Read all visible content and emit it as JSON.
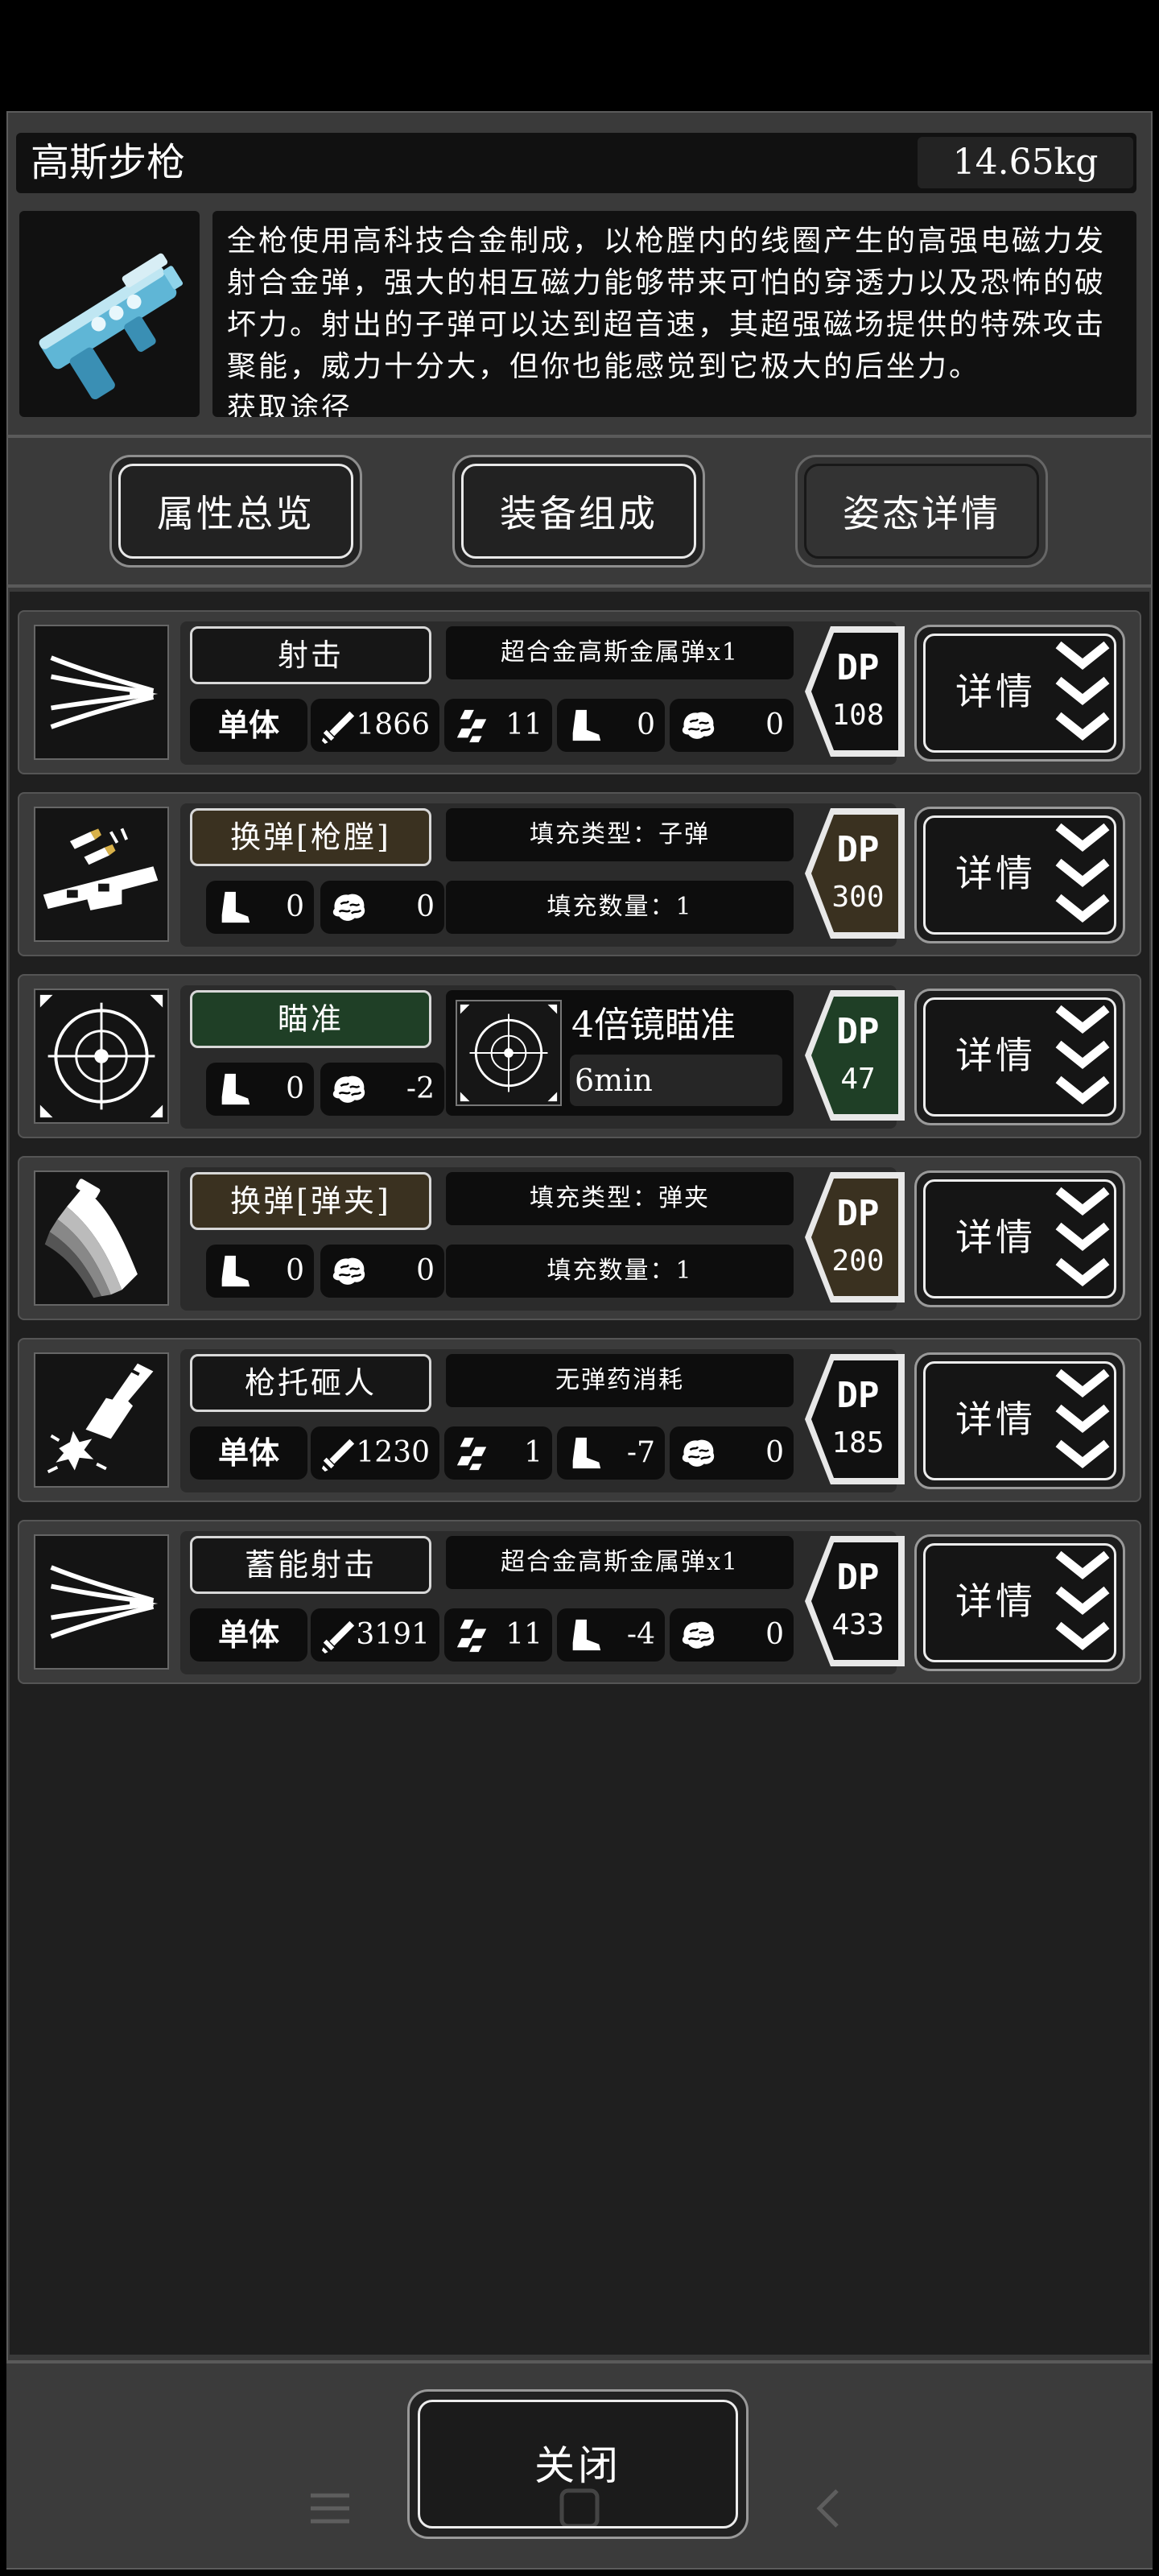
{
  "item": {
    "name": "高斯步枪",
    "weight": "14.65kg",
    "description": "全枪使用高科技合金制成，以枪膛内的线圈产生的高强电磁力发射合金弹，强大的相互磁力能够带来可怕的穿透力以及恐怖的破坏力。射出的子弹可以达到超音速，其超强磁场提供的特殊攻击聚能，威力十分大，但你也能感觉到它极大的后坐力。",
    "description_cut": "获取途径"
  },
  "tabs": [
    {
      "label": "属性总览"
    },
    {
      "label": "装备组成"
    },
    {
      "label": "姿态详情"
    }
  ],
  "actions": [
    {
      "name": "射击",
      "name_style": "dark",
      "icon": "claw-slash-icon",
      "info": "超合金高斯金属弹x1",
      "target": "单体",
      "damage": "1866",
      "hits": "11",
      "move": "0",
      "mind": "0",
      "dp": "108",
      "dp_color": "#111111",
      "detail_label": "详情"
    },
    {
      "name": "换弹[枪膛]",
      "name_style": "brown",
      "icon": "chamber-reload-icon",
      "fill_type": "填充类型：子弹",
      "fill_count": "填充数量：1",
      "move": "0",
      "mind": "0",
      "dp": "300",
      "dp_color": "#3a3120",
      "detail_label": "详情"
    },
    {
      "name": "瞄准",
      "name_style": "green",
      "icon": "crosshair-icon",
      "aim_title": "4倍镜瞄准",
      "aim_time": "6min",
      "move": "0",
      "mind": "-2",
      "dp": "47",
      "dp_color": "#1f3f26",
      "detail_label": "详情"
    },
    {
      "name": "换弹[弹夹]",
      "name_style": "brown",
      "icon": "magazine-reload-icon",
      "fill_type": "填充类型：弹夹",
      "fill_count": "填充数量：1",
      "move": "0",
      "mind": "0",
      "dp": "200",
      "dp_color": "#3a3120",
      "detail_label": "详情"
    },
    {
      "name": "枪托砸人",
      "name_style": "dark",
      "icon": "rifle-butt-strike-icon",
      "info": "无弹药消耗",
      "target": "单体",
      "damage": "1230",
      "hits": "1",
      "move": "-7",
      "mind": "0",
      "dp": "185",
      "dp_color": "#111111",
      "detail_label": "详情"
    },
    {
      "name": "蓄能射击",
      "name_style": "dark",
      "icon": "claw-slash-icon",
      "info": "超合金高斯金属弹x1",
      "target": "单体",
      "damage": "3191",
      "hits": "11",
      "move": "-4",
      "mind": "0",
      "dp": "433",
      "dp_color": "#111111",
      "detail_label": "详情"
    }
  ],
  "close_label": "关闭"
}
